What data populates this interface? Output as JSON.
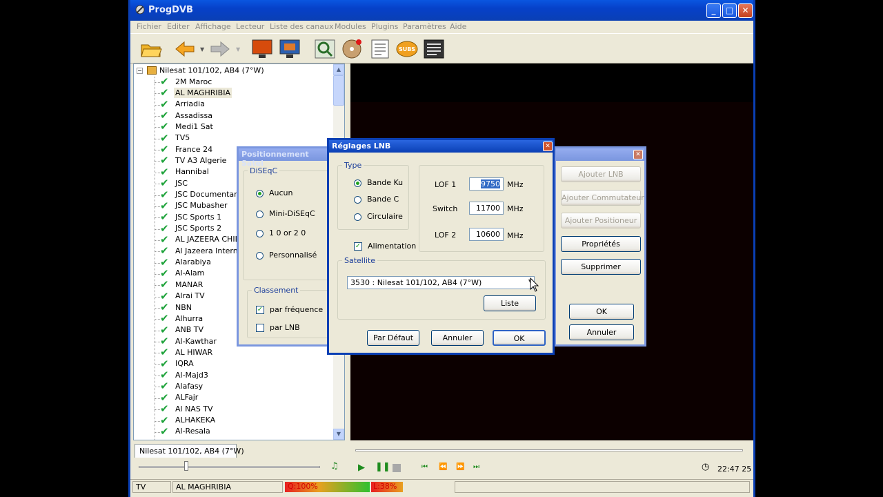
{
  "app": {
    "title": "ProgDVB"
  },
  "menu": [
    "Fichier",
    "Editer",
    "Affichage",
    "Lecteur",
    "Liste des canaux",
    "Modules",
    "Plugins",
    "Paramètres",
    "Aide"
  ],
  "tree": {
    "root": "Nilesat 101/102, AB4 (7°W)",
    "channels": [
      "2M Maroc",
      "AL MAGHRIBIA",
      "Arriadia",
      "Assadissa",
      "Medi1 Sat",
      "TV5",
      "France 24",
      "TV A3 Algerie",
      "Hannibal",
      "JSC",
      "JSC Documentary",
      "JSC Mubasher",
      "JSC Sports 1",
      "JSC Sports 2",
      "AL JAZEERA CHILD",
      "Al Jazeera Interna",
      "Alarabiya",
      "Al-Alam",
      "MANAR",
      "Alrai TV",
      "NBN",
      "Alhurra",
      "ANB TV",
      "Al-Kawthar",
      "AL HIWAR",
      "IQRA",
      "Al-Majd3",
      "Alafasy",
      "ALFajr",
      "Al NAS TV",
      "ALHAKEKA",
      "Al-Resala"
    ],
    "selected": "AL MAGHRIBIA",
    "tab": "Nilesat 101/102, AB4 (7°W)"
  },
  "player": {
    "time": "22:47 25"
  },
  "status": {
    "type": "TV",
    "channel": "AL MAGHRIBIA",
    "quality": "Q:100%",
    "level": "L:38%",
    "quality_value": 100,
    "level_value": 38
  },
  "dlg_pos": {
    "title": "Positionnement Satel",
    "diseqc_legend": "DiSEqC",
    "diseqc_options": [
      "Aucun",
      "Mini-DiSEqC",
      "1 0 or 2 0",
      "Personnalisé"
    ],
    "diseqc_selected": 0,
    "sort_legend": "Classement",
    "sort_options": [
      "par fréquence",
      "par LNB"
    ],
    "sort_checked": [
      true,
      false
    ]
  },
  "dlg_right": {
    "buttons": [
      "Ajouter LNB",
      "Ajouter Commutateur",
      "Ajouter Positioneur",
      "Propriétés",
      "Supprimer"
    ],
    "ok": "OK",
    "cancel": "Annuler"
  },
  "dlg_lnb": {
    "title": "Réglages LNB",
    "type_legend": "Type",
    "types": [
      "Bande Ku",
      "Bande C",
      "Circulaire"
    ],
    "type_selected": 0,
    "lof1_label": "LOF 1",
    "lof1_value": "9750",
    "switch_label": "Switch",
    "switch_value": "11700",
    "lof2_label": "LOF 2",
    "lof2_value": "10600",
    "unit": "MHz",
    "power_label": "Alimentation",
    "power_checked": true,
    "sat_legend": "Satellite",
    "sat_value": "3530 : Nilesat 101/102, AB4 (7°W)",
    "list_button": "Liste",
    "default_button": "Par Défaut",
    "cancel_button": "Annuler",
    "ok_button": "OK"
  }
}
